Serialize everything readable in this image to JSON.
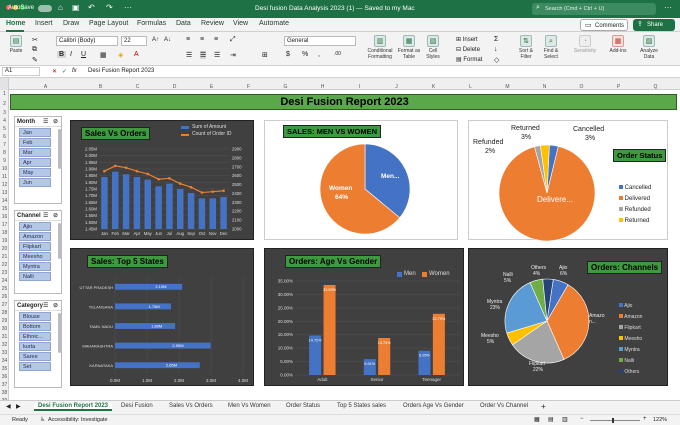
{
  "titlebar": {
    "autosave": "AutoSave",
    "filename": "Desi fusion Data Analysis 2023 (1) — Saved to my Mac",
    "search_placeholder": "Search (Cmd + Ctrl + U)"
  },
  "ribbon_tabs": [
    "Home",
    "Insert",
    "Draw",
    "Page Layout",
    "Formulas",
    "Data",
    "Review",
    "View",
    "Automate"
  ],
  "ribbon_buttons": {
    "comments": "Comments",
    "share": "Share",
    "paste": "Paste",
    "font": "Calibri (Body)",
    "font_size": "22",
    "number_format": "General",
    "cond_format": "Conditional Formatting",
    "format_table": "Format as Table",
    "cell_styles": "Cell Styles",
    "insert": "Insert",
    "delete": "Delete",
    "format": "Format",
    "sort_filter": "Sort & Filter",
    "find_select": "Find & Select",
    "sensitivity": "Sensitivity",
    "addins": "Add-ins",
    "analyze": "Analyze Data"
  },
  "formula_bar": {
    "cell_ref": "A1",
    "fx": "fx",
    "content": "Desi Fusion Report 2023"
  },
  "columns": [
    "A",
    "B",
    "C",
    "D",
    "E",
    "F",
    "G",
    "H",
    "I",
    "J",
    "K",
    "L",
    "M",
    "N",
    "O",
    "P",
    "Q"
  ],
  "rows": [
    "1",
    "2",
    "3",
    "4",
    "5",
    "6",
    "7",
    "8",
    "9",
    "10",
    "11",
    "12",
    "13",
    "14",
    "15",
    "16",
    "17",
    "18",
    "19",
    "20",
    "21",
    "22",
    "23",
    "24",
    "25",
    "26",
    "27",
    "28",
    "29",
    "30",
    "31",
    "32",
    "33",
    "34",
    "35",
    "36",
    "37",
    "38",
    "39"
  ],
  "report_title": "Desi Fusion Report 2023",
  "slicers": [
    {
      "title": "Month",
      "items": [
        "Jan",
        "Feb",
        "Mar",
        "Apr",
        "May",
        "Jun"
      ]
    },
    {
      "title": "Channel",
      "items": [
        "Ajio",
        "Amazon",
        "Flipkart",
        "Meesho",
        "Myntra",
        "Nalli"
      ]
    },
    {
      "title": "Category",
      "items": [
        "Blouse",
        "Bottom",
        "Ethnic...",
        "kurta",
        "Saree",
        "Set"
      ]
    }
  ],
  "charts": {
    "sales_orders": {
      "title": "Sales Vs Orders",
      "legend": [
        "Sum of Amount",
        "Count of Order ID"
      ]
    },
    "men_women": {
      "title": "SALES: MEN VS WOMEN",
      "women_label": "Women",
      "women_pct": "64%",
      "men_label": "Men..."
    },
    "order_status": {
      "title": "Order Status",
      "labels": {
        "returned": "Returned",
        "returned_pct": "3%",
        "cancelled": "Cancelled",
        "cancelled_pct": "3%",
        "refunded": "Refunded",
        "refunded_pct": "2%",
        "delivered": "Delivere..."
      },
      "legend": [
        "Cancelled",
        "Delivered",
        "Refunded",
        "Returned"
      ]
    },
    "top5": {
      "title": "Sales: Top 5 States"
    },
    "age_gender": {
      "title": "Orders: Age Vs Gender",
      "legend": [
        "Men",
        "Women"
      ]
    },
    "channels": {
      "title": "Orders: Channels",
      "legend": [
        "Ajio",
        "Amazon",
        "Flipkart",
        "Meesho",
        "Myntra",
        "Nalli",
        "Others"
      ],
      "labels": {
        "others": "Others",
        "others_pct": "4%",
        "ajio": "Ajio",
        "ajio_pct": "6%",
        "nalli": "Nalli",
        "nalli_pct": "5%",
        "myntra": "Myntra",
        "myntra_pct": "23%",
        "meesho": "Meesho",
        "meesho_pct": "5%",
        "flipkart": "Flipkart",
        "flipkart_pct": "22%",
        "amazon": "Amazo n..."
      }
    }
  },
  "chart_data": [
    {
      "type": "bar+line",
      "title": "Sales Vs Orders",
      "categories": [
        "Jan",
        "Feb",
        "Mar",
        "Apr",
        "May",
        "Jun",
        "Jul",
        "Aug",
        "Sep",
        "Oct",
        "Nov",
        "Dec"
      ],
      "series": [
        {
          "name": "Sum of Amount",
          "type": "bar",
          "axis": "left",
          "values": [
            1.84,
            1.88,
            1.86,
            1.84,
            1.82,
            1.77,
            1.79,
            1.75,
            1.72,
            1.68,
            1.68,
            1.69
          ]
        },
        {
          "name": "Count of Order ID",
          "type": "line",
          "axis": "right",
          "values": [
            2650,
            2710,
            2690,
            2650,
            2620,
            2560,
            2570,
            2510,
            2470,
            2410,
            2420,
            2430
          ]
        }
      ],
      "y_left": {
        "ticks": [
          "1.45M",
          "1.50M",
          "1.55M",
          "1.60M",
          "1.65M",
          "1.70M",
          "1.75M",
          "1.80M",
          "1.85M",
          "1.90M",
          "1.95M",
          "2.00M",
          "2.05M"
        ],
        "range": [
          1.45,
          2.05
        ]
      },
      "y_right": {
        "ticks": [
          "2000",
          "2100",
          "2200",
          "2300",
          "2400",
          "2500",
          "2600",
          "2700",
          "2800",
          "2900"
        ],
        "range": [
          2000,
          2900
        ]
      }
    },
    {
      "type": "pie",
      "title": "SALES: MEN VS WOMEN",
      "series": [
        {
          "name": "Women",
          "value": 64,
          "color": "#ed7d31"
        },
        {
          "name": "Men",
          "value": 36,
          "color": "#4472c4"
        }
      ]
    },
    {
      "type": "pie",
      "title": "Order Status",
      "series": [
        {
          "name": "Cancelled",
          "value": 3,
          "color": "#4472c4"
        },
        {
          "name": "Delivered",
          "value": 92,
          "color": "#ed7d31"
        },
        {
          "name": "Refunded",
          "value": 2,
          "color": "#a5a5a5"
        },
        {
          "name": "Returned",
          "value": 3,
          "color": "#ffc000"
        }
      ],
      "legend_position": "right"
    },
    {
      "type": "bar",
      "orientation": "horizontal",
      "title": "Sales: Top 5 States",
      "categories": [
        "UTTAR PRADESH",
        "TELANGANA",
        "TAMIL NADU",
        "MAHARASHTRA",
        "KARNATAKA"
      ],
      "values": [
        2.1,
        1.75,
        1.88,
        2.99,
        2.65
      ],
      "labels": [
        "2.10M",
        "1.75M",
        "1.88M",
        "2.99M",
        "2.65M"
      ],
      "xlim": [
        0,
        4
      ],
      "x_ticks": [
        "0.0M",
        "1.0M",
        "2.0M",
        "3.0M",
        "4.0M"
      ]
    },
    {
      "type": "bar",
      "title": "Orders: Age Vs Gender",
      "categories": [
        "Adult",
        "Senior",
        "Teenager"
      ],
      "series": [
        {
          "name": "Men",
          "values": [
            14.72,
            5.91,
            9.05
          ],
          "color": "#4472c4"
        },
        {
          "name": "Women",
          "values": [
            33.53,
            13.78,
            22.79
          ],
          "color": "#ed7d31"
        }
      ],
      "labels": [
        [
          "14.72%",
          "5.91%",
          "9.05%"
        ],
        [
          "33.53%",
          "13.78%",
          "22.79%"
        ]
      ],
      "ylim": [
        0,
        35
      ],
      "y_ticks": [
        "0.00%",
        "5.00%",
        "10.00%",
        "15.00%",
        "20.00%",
        "25.00%",
        "30.00%",
        "35.00%"
      ]
    },
    {
      "type": "pie",
      "title": "Orders: Channels",
      "series": [
        {
          "name": "Ajio",
          "value": 6,
          "color": "#4472c4"
        },
        {
          "name": "Amazon",
          "value": 35,
          "color": "#ed7d31"
        },
        {
          "name": "Flipkart",
          "value": 22,
          "color": "#a5a5a5"
        },
        {
          "name": "Meesho",
          "value": 5,
          "color": "#ffc000"
        },
        {
          "name": "Myntra",
          "value": 23,
          "color": "#5b9bd5"
        },
        {
          "name": "Nalli",
          "value": 5,
          "color": "#70ad47"
        },
        {
          "name": "Others",
          "value": 4,
          "color": "#264478"
        }
      ],
      "legend_position": "right"
    }
  ],
  "sheet_tabs": [
    "Desi Fusion Report 2023",
    "Desi Fusion",
    "Sales Vs Orders",
    "Men Vs Women",
    "Order Status",
    "Top 5 States sales",
    "Orders Age Vs Gender",
    "Order Vs Channel"
  ],
  "status": {
    "ready": "Ready",
    "accessibility": "Accessibility: Investigate",
    "zoom": "122%"
  }
}
